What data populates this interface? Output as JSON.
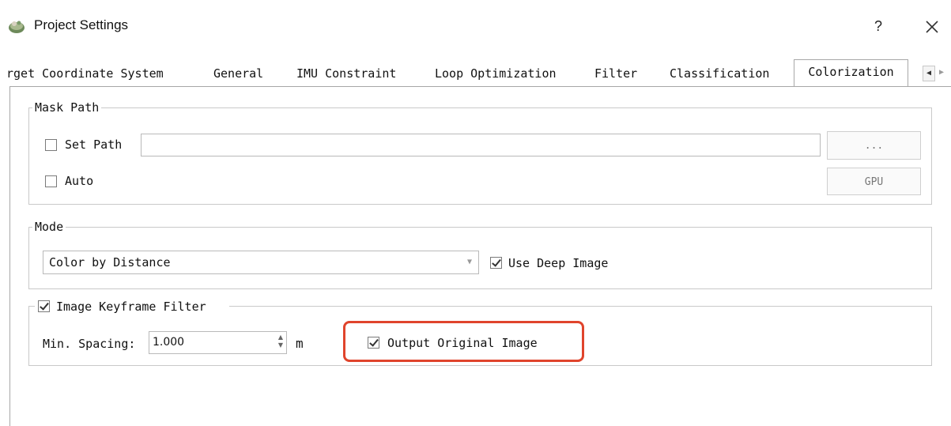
{
  "window": {
    "title": "Project Settings",
    "help_label": "?"
  },
  "tabs": [
    {
      "label": "rget Coordinate System"
    },
    {
      "label": "General"
    },
    {
      "label": "IMU Constraint"
    },
    {
      "label": "Loop Optimization"
    },
    {
      "label": "Filter"
    },
    {
      "label": "Classification"
    },
    {
      "label": "Colorization",
      "active": true
    }
  ],
  "mask_path": {
    "legend": "Mask Path",
    "set_path_label": "Set Path",
    "set_path_checked": false,
    "path_value": "",
    "browse_label": "...",
    "auto_label": "Auto",
    "auto_checked": false,
    "gpu_label": "GPU"
  },
  "mode": {
    "legend": "Mode",
    "selected": "Color by Distance",
    "use_deep_image_label": "Use Deep Image",
    "use_deep_image_checked": true
  },
  "keyframe_filter": {
    "legend": "Image Keyframe Filter",
    "enabled": true,
    "min_spacing_label": "Min. Spacing:",
    "min_spacing_value": "1.000",
    "unit": "m",
    "output_original_label": "Output Original Image",
    "output_original_checked": true
  },
  "colors": {
    "highlight": "#e0442c",
    "border": "#c9c9c9"
  }
}
